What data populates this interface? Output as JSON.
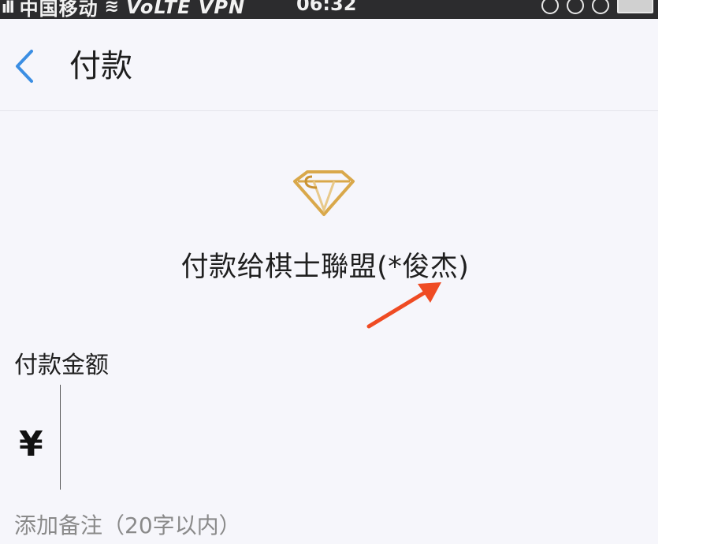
{
  "status_bar": {
    "carrier": "中国移动",
    "network": "VoLTE VPN",
    "time": "06:32"
  },
  "nav": {
    "back_icon": "chevron-left-icon",
    "title": "付款"
  },
  "merchant": {
    "logo_icon": "diamond-logo-icon",
    "payee_text": "付款给棋士聯盟(*俊杰)",
    "annotation": "red-arrow-icon"
  },
  "amount": {
    "label": "付款金额",
    "currency": "¥",
    "value": ""
  },
  "note": {
    "label": "添加备注（20字以内）"
  },
  "colors": {
    "back_arrow": "#3b8ee3",
    "annotation_arrow": "#ef4b23",
    "logo_gold": "#d9a84a",
    "background": "#f6f6fb"
  }
}
